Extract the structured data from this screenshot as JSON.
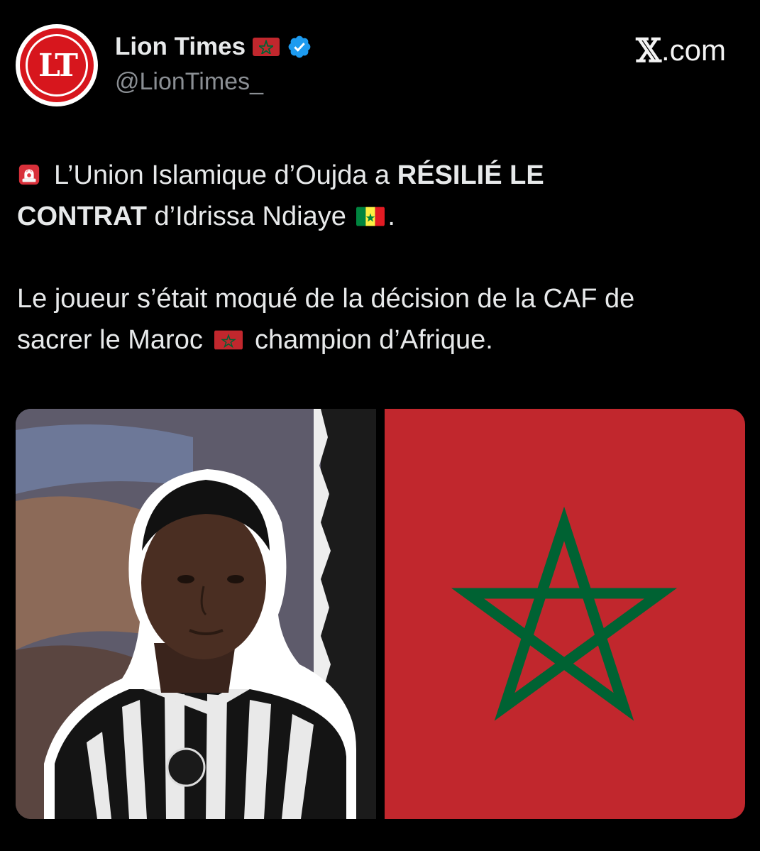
{
  "header": {
    "display_name": "Lion Times",
    "handle": "@LionTimes_",
    "avatar_text": "LT",
    "brand": "X.com",
    "brand_x": "𝕏",
    "brand_suffix": ".com"
  },
  "tweet": {
    "p1_a": "L’Union Islamique d’Oujda a ",
    "p1_bold_1": "RÉSILIÉ LE",
    "p1_bold_2": "CONTRAT",
    "p1_b": " d’Idrissa Ndiaye ",
    "p1_end": ".",
    "p2_a": "Le joueur s’était moqué de la décision de la CAF de",
    "p2_b": "sacrer le Maroc ",
    "p2_c": " champion d’Afrique."
  },
  "media": {
    "left_image": "player-photo",
    "right_image": "morocco-flag"
  },
  "colors": {
    "background": "#000000",
    "text": "#e7e9ea",
    "handle": "#8b8f94",
    "verified": "#1d9bf0",
    "morocco_red": "#c1272d",
    "morocco_green": "#006233",
    "avatar_red": "#d7161d"
  },
  "icons": [
    "siren-icon",
    "morocco-flag-icon",
    "senegal-flag-icon",
    "verified-badge-icon"
  ]
}
